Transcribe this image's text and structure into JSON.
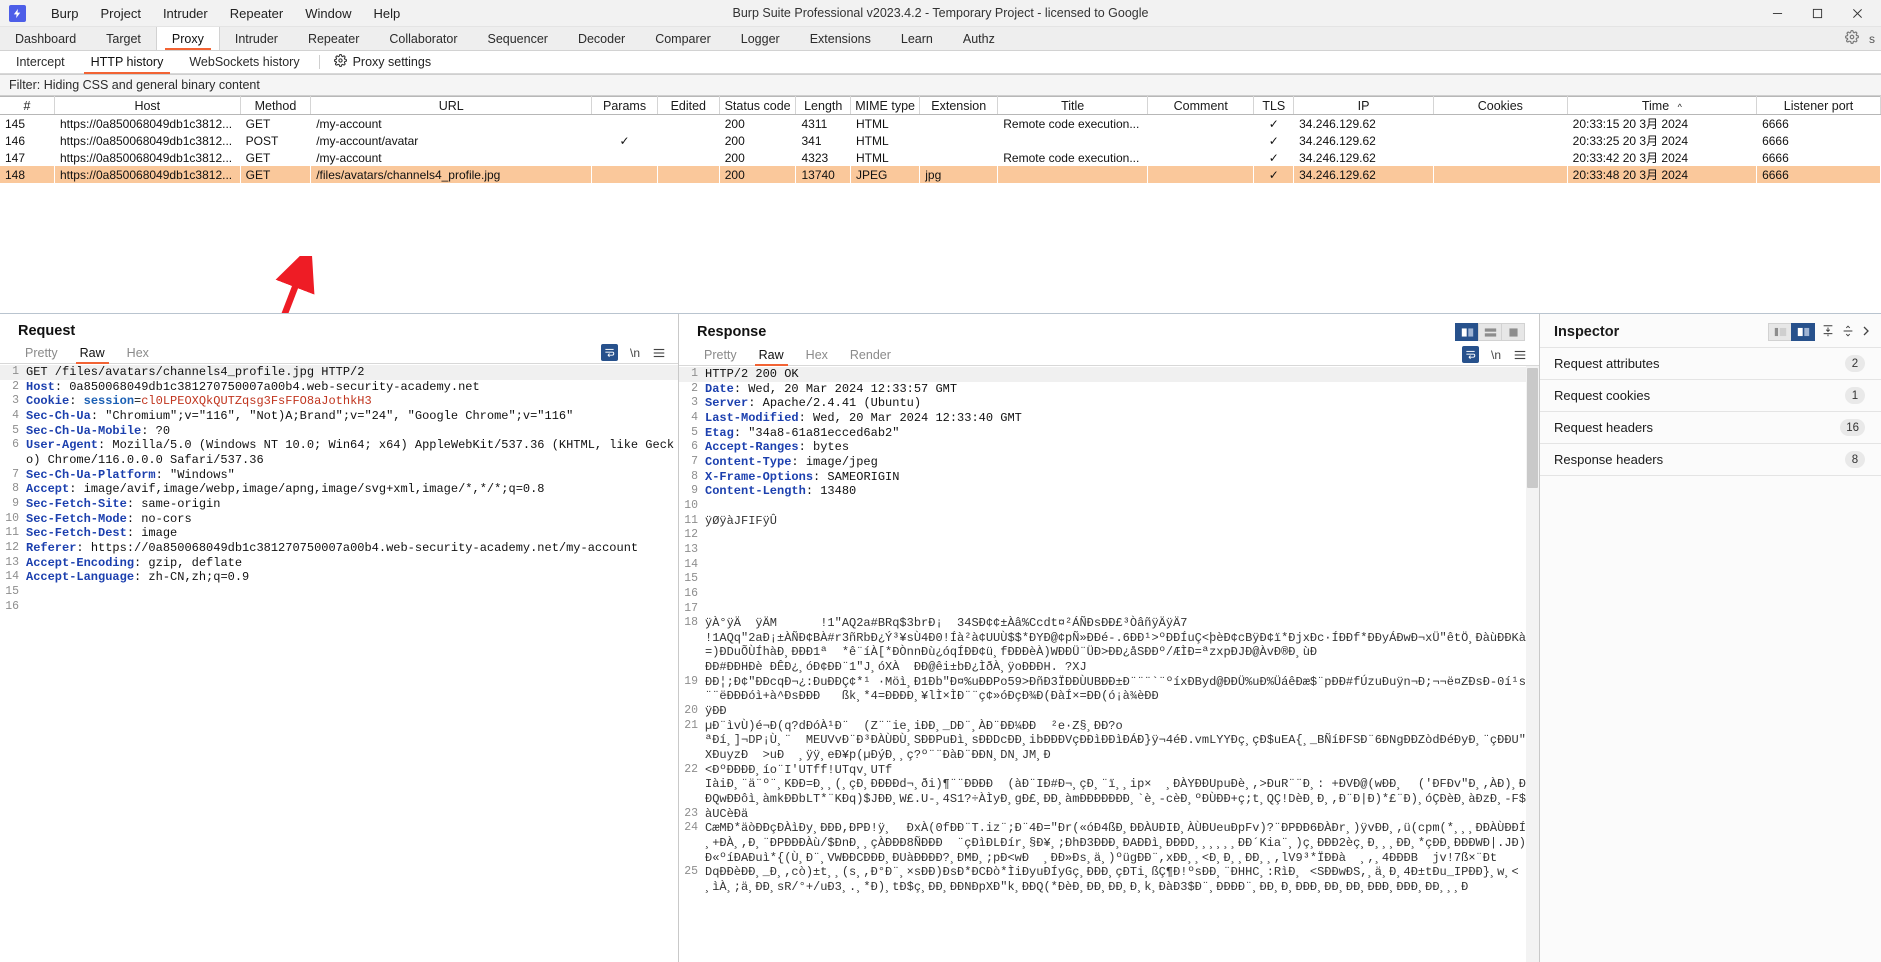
{
  "window": {
    "title": "Burp Suite Professional v2023.4.2 - Temporary Project - licensed to Google",
    "logo_icon": "burp-lightning-icon",
    "minimize_icon": "—",
    "maximize_icon": "□",
    "close_icon": "✕"
  },
  "menubar": {
    "items": [
      "Burp",
      "Project",
      "Intruder",
      "Repeater",
      "Window",
      "Help"
    ]
  },
  "main_tabs": {
    "items": [
      "Dashboard",
      "Target",
      "Proxy",
      "Intruder",
      "Repeater",
      "Collaborator",
      "Sequencer",
      "Decoder",
      "Comparer",
      "Logger",
      "Extensions",
      "Learn",
      "Authz"
    ],
    "active": "Proxy",
    "settings_icon": "gear-icon",
    "right_label": "s"
  },
  "sub_tabs": {
    "items": [
      "Intercept",
      "HTTP history",
      "WebSockets history"
    ],
    "active": "HTTP history",
    "proxy_settings_label": "Proxy settings",
    "proxy_settings_icon": "gear-icon"
  },
  "filter": {
    "label": "Filter: Hiding CSS and general binary content"
  },
  "history_table": {
    "columns": [
      "#",
      "Host",
      "Method",
      "URL",
      "Params",
      "Edited",
      "Status code",
      "Length",
      "MIME type",
      "Extension",
      "Title",
      "Comment",
      "TLS",
      "IP",
      "Cookies",
      "Time",
      "Listener port"
    ],
    "sort_column": "Time",
    "sort_icon": "chevron-up-icon",
    "check_glyph": "✓",
    "rows": [
      {
        "num": "145",
        "host": "https://0a850068049db1c3812...",
        "method": "GET",
        "url": "/my-account",
        "params": "",
        "edited": "",
        "status": "200",
        "length": "4311",
        "mime": "HTML",
        "extension": "",
        "title": "Remote code execution...",
        "comment": "",
        "tls": "✓",
        "ip": "34.246.129.62",
        "cookies": "",
        "time": "20:33:15 20 3月 2024",
        "port": "6666",
        "selected": false
      },
      {
        "num": "146",
        "host": "https://0a850068049db1c3812...",
        "method": "POST",
        "url": "/my-account/avatar",
        "params": "✓",
        "edited": "",
        "status": "200",
        "length": "341",
        "mime": "HTML",
        "extension": "",
        "title": "",
        "comment": "",
        "tls": "✓",
        "ip": "34.246.129.62",
        "cookies": "",
        "time": "20:33:25 20 3月 2024",
        "port": "6666",
        "selected": false
      },
      {
        "num": "147",
        "host": "https://0a850068049db1c3812...",
        "method": "GET",
        "url": "/my-account",
        "params": "",
        "edited": "",
        "status": "200",
        "length": "4323",
        "mime": "HTML",
        "extension": "",
        "title": "Remote code execution...",
        "comment": "",
        "tls": "✓",
        "ip": "34.246.129.62",
        "cookies": "",
        "time": "20:33:42 20 3月 2024",
        "port": "6666",
        "selected": false
      },
      {
        "num": "148",
        "host": "https://0a850068049db1c3812...",
        "method": "GET",
        "url": "/files/avatars/channels4_profile.jpg",
        "params": "",
        "edited": "",
        "status": "200",
        "length": "13740",
        "mime": "JPEG",
        "extension": "jpg",
        "title": "",
        "comment": "",
        "tls": "✓",
        "ip": "34.246.129.62",
        "cookies": "",
        "time": "20:33:48 20 3月 2024",
        "port": "6666",
        "selected": true
      }
    ]
  },
  "request_pane": {
    "title": "Request",
    "tabs": [
      "Pretty",
      "Raw",
      "Hex"
    ],
    "active_tab": "Raw",
    "newline_label": "\\n",
    "menu_icon": "hamburger-icon",
    "wrap_icon": "word-wrap-icon",
    "lines": [
      {
        "n": "1",
        "type": "start",
        "text": "GET /files/avatars/channels4_profile.jpg HTTP/2"
      },
      {
        "n": "2",
        "type": "header",
        "key": "Host",
        "value": " 0a850068049db1c381270750007a00b4.web-security-academy.net"
      },
      {
        "n": "3",
        "type": "cookie",
        "key": "Cookie",
        "name": " session",
        "value": "cl0LPEOXQkQUTZqsg3FsFFO8aJothkH3"
      },
      {
        "n": "4",
        "type": "header",
        "key": "Sec-Ch-Ua",
        "value": " \"Chromium\";v=\"116\", \"Not)A;Brand\";v=\"24\", \"Google Chrome\";v=\"116\""
      },
      {
        "n": "5",
        "type": "header",
        "key": "Sec-Ch-Ua-Mobile",
        "value": " ?0"
      },
      {
        "n": "6",
        "type": "header",
        "key": "User-Agent",
        "value": " Mozilla/5.0 (Windows NT 10.0; Win64; x64) AppleWebKit/537.36 (KHTML, like Gecko) Chrome/116.0.0.0 Safari/537.36"
      },
      {
        "n": "7",
        "type": "header",
        "key": "Sec-Ch-Ua-Platform",
        "value": " \"Windows\""
      },
      {
        "n": "8",
        "type": "header",
        "key": "Accept",
        "value": " image/avif,image/webp,image/apng,image/svg+xml,image/*,*/*;q=0.8"
      },
      {
        "n": "9",
        "type": "header",
        "key": "Sec-Fetch-Site",
        "value": " same-origin"
      },
      {
        "n": "10",
        "type": "header",
        "key": "Sec-Fetch-Mode",
        "value": " no-cors"
      },
      {
        "n": "11",
        "type": "header",
        "key": "Sec-Fetch-Dest",
        "value": " image"
      },
      {
        "n": "12",
        "type": "header",
        "key": "Referer",
        "value": " https://0a850068049db1c381270750007a00b4.web-security-academy.net/my-account"
      },
      {
        "n": "13",
        "type": "header",
        "key": "Accept-Encoding",
        "value": " gzip, deflate"
      },
      {
        "n": "14",
        "type": "header",
        "key": "Accept-Language",
        "value": " zh-CN,zh;q=0.9"
      },
      {
        "n": "15",
        "type": "blank",
        "text": ""
      },
      {
        "n": "16",
        "type": "blank",
        "text": ""
      }
    ]
  },
  "response_pane": {
    "title": "Response",
    "tabs": [
      "Pretty",
      "Raw",
      "Hex",
      "Render"
    ],
    "active_tab": "Raw",
    "newline_label": "\\n",
    "menu_icon": "hamburger-icon",
    "wrap_icon": "word-wrap-icon",
    "layout_icons": [
      "split-vertical-icon",
      "split-horizontal-icon",
      "single-pane-icon"
    ],
    "layout_active": 0,
    "lines": [
      {
        "n": "1",
        "type": "start",
        "text": "HTTP/2 200 OK"
      },
      {
        "n": "2",
        "type": "header",
        "key": "Date",
        "value": " Wed, 20 Mar 2024 12:33:57 GMT"
      },
      {
        "n": "3",
        "type": "header",
        "key": "Server",
        "value": " Apache/2.4.41 (Ubuntu)"
      },
      {
        "n": "4",
        "type": "header",
        "key": "Last-Modified",
        "value": " Wed, 20 Mar 2024 12:33:40 GMT"
      },
      {
        "n": "5",
        "type": "header",
        "key": "Etag",
        "value": " \"34a8-61a81ecced6ab2\""
      },
      {
        "n": "6",
        "type": "header",
        "key": "Accept-Ranges",
        "value": " bytes"
      },
      {
        "n": "7",
        "type": "header",
        "key": "Content-Type",
        "value": " image/jpeg"
      },
      {
        "n": "8",
        "type": "header",
        "key": "X-Frame-Options",
        "value": " SAMEORIGIN"
      },
      {
        "n": "9",
        "type": "header",
        "key": "Content-Length",
        "value": " 13480"
      },
      {
        "n": "10",
        "type": "blank",
        "text": ""
      },
      {
        "n": "11",
        "type": "bin",
        "text": "ÿØÿàJFIFÿÛ"
      },
      {
        "n": "12",
        "type": "blank",
        "text": ""
      },
      {
        "n": "13",
        "type": "blank",
        "text": ""
      },
      {
        "n": "14",
        "type": "blank",
        "text": ""
      },
      {
        "n": "15",
        "type": "blank",
        "text": ""
      },
      {
        "n": "16",
        "type": "blank",
        "text": ""
      },
      {
        "n": "17",
        "type": "blank",
        "text": ""
      },
      {
        "n": "18",
        "type": "bin",
        "text": "ÿÀ°ÿÄ  ÿÄM      !1\"AQ2a#BRq$3brÐ¡  34SÐ¢¢±Àâ%Ccdt¤²ÁÑÐsÐÐ£³ÒâñÿÄÿÄ7\n!1AQq\"2aÐ¡±ÀÑÐ¢BÀ#r3ñRbÐ¿Ý³¥sÙ4Ð0!Íà²à¢UUÙ$$*ÐYÐ@¢pÑ»ÐÐé-.6ÐÐ¹>ºÐÐÍuÇ<þèÐ¢cBÿÐ¢ï*ÐjxÐc·ÍÐÐf*ÐÐyÁÐwÐ¬xÜ\"êtÖ¸ÐàùÐÐKà=)ÐDuÕÙÍhàÐ¸ÐÐÐ1ª  *ê¨íÀ[*ÐÒnnÐù¿óqÍÐÐ¢ü¸fÐÐÐèÀ)WÐÐÜ¨ÜÐ>ÐÐ¿åSÐÐº/ÆÌÐ=ªzxpÐJÐ@ÀvÐ®Ð¸ùÐ\nÐÐ#ÐÐHÐè ÐÊÐ¿¸óÐ¢ÐÐ¨1\"J¸óXÀ  ÐÐ@êi±bÐ¿ÌðÀ¸ÿoÐÐÐH. ?XJ"
      },
      {
        "n": "19",
        "type": "bin",
        "text": "ÐÐ¦;Ð¢\"ÐÐcqÐ¬¿:ÐuÐÐÇ¢*¹ ·Möì¸Ð1Ðb\"Ð¤%uÐÐPo59>ÐñÐ3ÏÐÐÙUBÐÐ±Ð¨¨¨`¨ºíxÐByd@ÐÐÜ%uÐ%ÜáêÐæ$¨pÐÐ#fÚzuÐuÿn¬Ð;¬¬ë¤ZÐsÐ-0í¹s1¨¨ëÐÐÐóì+à^ÐsÐÐÐ   ßk¸*4=ÐÐÐÐ¸¥lÌ×ÌÐ¨¨ç¢»óÐçÐ¾Ð(ÐàÍ×=ÐÐ(ó¡à¾èÐÐ"
      },
      {
        "n": "20",
        "type": "bin",
        "text": "ÿÐÐ"
      },
      {
        "n": "21",
        "type": "bin",
        "text": "µÐ¨ìvÙ)é¬Ð(q?dÐóÀ¹Ð¨  (Z¨¨ie¸iÐÐ¸_DÐ¨¸ÀÐ¨ÐÐ¼ÐÐ  ²e·Z§¸ÐÐ?o\nªÐí¸]¬DP¡Ù¸¨  MEUVvÐ¨Ð³ÐÀÙÐÙ¸SÐÐPuÐì¸sÐÐDcÐÐ¸ibÐÐÐVçÐÐìÐÐìÐÁÐ}ÿ¬4éÐ.vmLYYÐç¸çÐ$uEA{¸_BÑíÐFSÐ¨6ÐNgÐÐZòdÐéÐyÐ¸¨çÐÐU\"ÐXÐuyzÐ  >uÐ  ¸ÿÿ¸eÐ¥p(µÐýÐ¸¸ç?º¨¨ÐàÐ¨ÐÐN¸DN¸JM¸Ð"
      },
      {
        "n": "22",
        "type": "bin",
        "text": "<ÐºÐÐÐÐ¸ío¨I'UTff!UTqv¸UTf\nIàiÐ¸¨ä¨º¨¸KÐÐ=Ð¸¸(¸çÐ¸ÐÐÐÐd¬¸ði)¶¨¨ÐÐÐÐ  (àÐ¨IÐ#Ð¬¸çÐ¸¨ï¸¸ip×  ¸ÐÀYÐÐUpuÐè¸,>ÐuR¨¨Ð¸: +ÐVÐ@(wÐÐ¸  ('ÐFÐv\"Ð¸,ÀÐ)¸ÐìÐQwÐÐôì¸àmkÐÐbLT*¨KÐq)$JÐÐ¸W£.U-¸4S1?÷ÀÌyÐ¸gÐ£¸ÐÐ¸àmÐÐÐÐÐÐÐ¸`è¸-cèÐ¸ºÐÙÐÐ+ç;t¸QÇ!DèÐ¸Ð¸,Ð¨Ð|Ð)*£¨Ð)¸óÇÐèÐ¸àÐzÐ¸-F$"
      },
      {
        "n": "23",
        "type": "bin",
        "text": "àUCèÐä"
      },
      {
        "n": "24",
        "type": "bin",
        "text": "CæMÐ*äòÐÐçÐÀìÐy¸ÐÐÐ,ÐPÐ!ÿ¸  ÐxÀ(0fÐÐ¨T.iz¨;Ð¨4Ð=\"Ðr(«óÐ4ßÐ¸ÐÐÀUÐIÐ¸ÀÙÐUeuÐpFv)?¨ÐPÐÐ6ÐÀÐr¸)ÿvÐÐ¸,ü(cpm(*¸¸¸ÐÐÀÙÐÐÍÐ  ¸+ÐÀ¸,Ð¸¨ÐPÐÐÐÀù/$ÐnÐ¸¸çÀÐÐÐ8ÑÐÐ­Ð  ¨çÐìÐLÐír¸§Ð¥¸;ÐhÐ3ÐÐÐ¸ÐAÐÐì¸ÐÐÐD¸¸¸¸¸¸ÐÐ´Kia¨¸)ç¸ÐÐÐ2èç¸Ð¸¸¸ÐÐ¸*çÐÐ¸ÐÐÐWÐ|.JÐ)YÐ«ºíÐAÐuì*{(Ù¸Ð¨¸VWÐÐCÐÐÐ¸ÐUàÐÐÐÐ?¸ÐMÐ¸;pÐ<wÐ  ¸ÐÐ»Ðs¸ä¸)ºügÐÐ¨,xÐÐ¸¸<Ð¸Ð¸¸ÐÐ¸¸,lV9³*ÏÐÐà  ¸,¸4ÐÐÐB  jv!7ß×¨Ðt"
      },
      {
        "n": "25",
        "type": "bin",
        "text": "DqÐÐèÐÐ¸_Ð¸,cò)±t¸¸(s¸,Ð°Ð¨¸×sÐÐ)ÐsÐ*ÐCÐò*ÌiÐyuÐÍyGç¸ÐÐÐ¸çÐTi¸ßÇ¶Ð!ºsÐÐ¸¨ÐHHC¸:RìÐ¸ <SÐÐwÐS,¸ä¸Ð¸4Ð±tÐu_IPÐÐ}¸w¸<\n¸ìÀ¸;ä¸ÐÐ¸sR/°+/uÐ3¸.¸*Ð)¸tÐ$ç¸ÐÐ¸ÐÐNÐpXÐ\"k¸ÐÐQ(*ÐèÐ¸ÐÐ¸ÐÐ¸Ð¸k¸ÐàÐ3$Ð¨¸ÐÐÐÐ¨¸ÐÐ¸Ð¸ÐÐÐ¸ÐÐ¸ÐÐ¸ÐÐÐ¸ÐÐÐ¸ÐÐ¸¸¸Ð"
      }
    ]
  },
  "inspector": {
    "title": "Inspector",
    "rows": [
      {
        "label": "Request attributes",
        "count": "2"
      },
      {
        "label": "Request cookies",
        "count": "1"
      },
      {
        "label": "Request headers",
        "count": "16"
      },
      {
        "label": "Response headers",
        "count": "8"
      }
    ],
    "layout_icons": [
      "panel-left-icon",
      "panel-right-icon",
      "collapse-all-icon",
      "expand-all-icon"
    ],
    "layout_active": 1
  },
  "annotation": {
    "arrow_color": "#ee1c25",
    "description": "red-arrow-pointing-to-selected-url"
  },
  "colors": {
    "accent": "#f26334",
    "selected_row": "#fac89b",
    "blue_button": "#27518c",
    "header_key": "#1b3fae",
    "cookie_value": "#c0341d"
  }
}
